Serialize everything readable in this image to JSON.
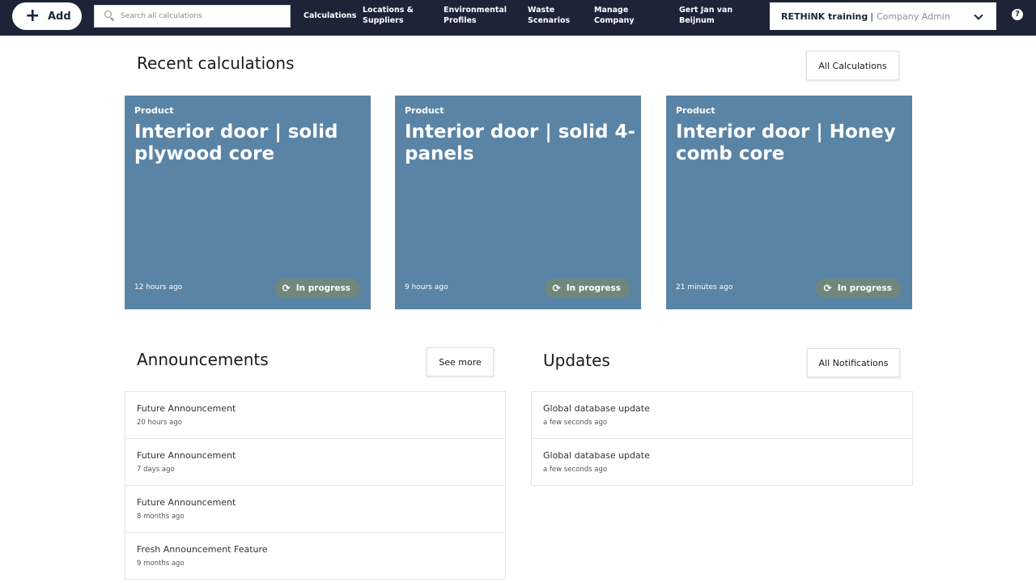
{
  "header": {
    "add_label": "Add",
    "add_icon": "plus-icon",
    "search_placeholder": "Search all calculations",
    "nav": [
      {
        "line1": "Calculations",
        "line2": ""
      },
      {
        "line1": "Locations &",
        "line2": "Suppliers"
      },
      {
        "line1": "Environmental",
        "line2": "Profiles"
      },
      {
        "line1": "Waste",
        "line2": "Scenarios"
      },
      {
        "line1": "Manage",
        "line2": "Company"
      },
      {
        "line1": "Gert Jan van",
        "line2": "Beijnum"
      }
    ],
    "company": {
      "name": "RETHiNK training",
      "separator": "|",
      "role": "Company Admin"
    },
    "help_label": "?"
  },
  "recent": {
    "title": "Recent calculations",
    "all_button": "All Calculations",
    "cards": [
      {
        "type": "Product",
        "title": "Interior door | solid plywood core",
        "time": "12 hours ago",
        "status": "In progress"
      },
      {
        "type": "Product",
        "title": "Interior door | solid 4-panels",
        "time": "9 hours ago",
        "status": "In progress"
      },
      {
        "type": "Product",
        "title": "Interior door | Honey comb core",
        "time": "21 minutes ago",
        "status": "In progress"
      }
    ]
  },
  "announcements": {
    "title": "Announcements",
    "button": "See more",
    "items": [
      {
        "title": "Future Announcement",
        "time": "20 hours ago"
      },
      {
        "title": "Future Announcement",
        "time": "7 days ago"
      },
      {
        "title": "Future Announcement",
        "time": "8 months ago"
      },
      {
        "title": "Fresh Announcement Feature",
        "time": "9 months ago"
      }
    ]
  },
  "updates": {
    "title": "Updates",
    "button": "All Notifications",
    "items": [
      {
        "title": "Global database update",
        "time": "a few seconds ago"
      },
      {
        "title": "Global database update",
        "time": "a few seconds ago"
      }
    ]
  },
  "colors": {
    "topbar": "#1e2438",
    "card": "#5a84a5",
    "status_pill": "#71877c"
  }
}
